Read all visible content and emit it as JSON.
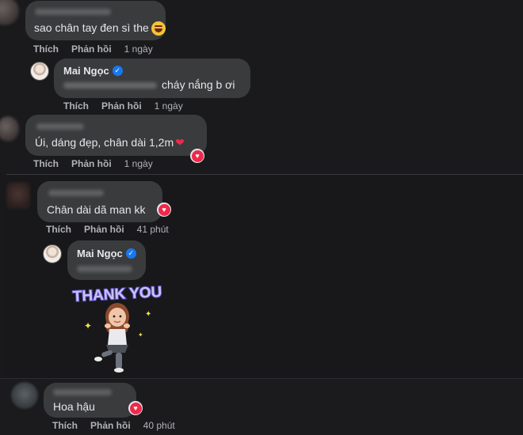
{
  "comments": [
    {
      "text": "sao chân tay đen sì the",
      "actions": {
        "like": "Thích",
        "reply": "Phản hồi",
        "time": "1 ngày"
      }
    },
    {
      "author": "Mai Ngọc",
      "text": "cháy nắng b ơi",
      "actions": {
        "like": "Thích",
        "reply": "Phản hồi",
        "time": "1 ngày"
      }
    },
    {
      "text": "Úi, dáng đẹp, chân dài 1,2m",
      "actions": {
        "like": "Thích",
        "reply": "Phản hồi",
        "time": "1 ngày"
      }
    },
    {
      "text": "Chân dài dã man kk",
      "actions": {
        "like": "Thích",
        "reply": "Phản hồi",
        "time": "41 phút"
      }
    },
    {
      "author": "Mai Ngọc",
      "sticker_text": "THANK YOU"
    },
    {
      "text": "Hoa hậu",
      "actions": {
        "like": "Thích",
        "reply": "Phản hồi",
        "time": "40 phút"
      }
    }
  ],
  "icons": {
    "verified": "verified-badge-icon",
    "heart_reaction": "heart-reaction-icon",
    "laugh_emoji": "laughing-emoji-icon",
    "heart_emoji": "red-heart-emoji-icon"
  },
  "colors": {
    "background": "#19191b",
    "bubble": "#3a3b3c",
    "text": "#e4e6eb",
    "secondary_text": "#b0b3b8",
    "verified": "#1877f2",
    "heart": "#f0284a"
  }
}
